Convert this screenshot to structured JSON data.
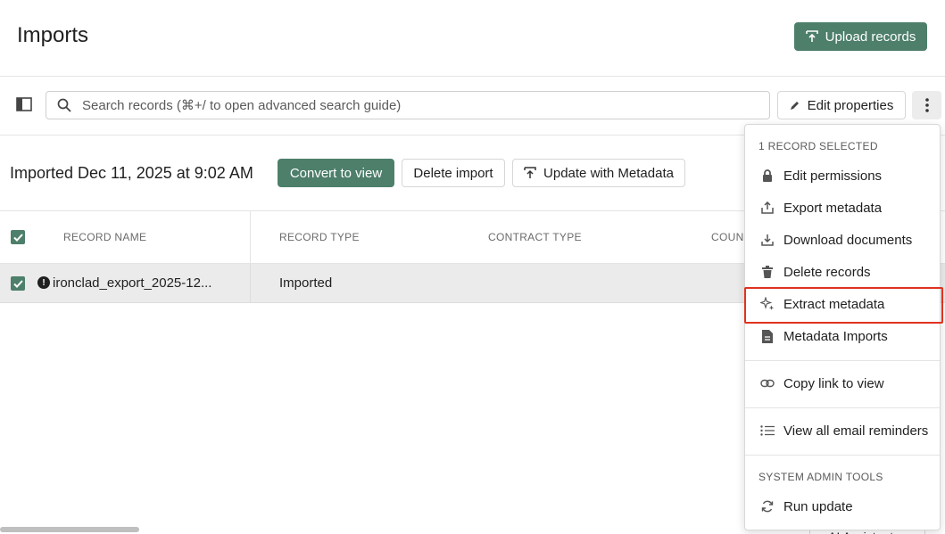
{
  "header": {
    "title": "Imports",
    "upload_label": "Upload records"
  },
  "toolbar": {
    "search_placeholder": "Search records (⌘+/ to open advanced search guide)",
    "edit_properties_label": "Edit properties"
  },
  "import_bar": {
    "title": "Imported Dec 11, 2025 at 9:02 AM",
    "convert_label": "Convert to view",
    "delete_label": "Delete import",
    "update_label": "Update with Metadata"
  },
  "table": {
    "columns": [
      "RECORD NAME",
      "RECORD TYPE",
      "CONTRACT TYPE",
      "COUN"
    ],
    "rows": [
      {
        "name": "ironclad_export_2025-12...",
        "type": "Imported"
      }
    ]
  },
  "menu": {
    "section_selected": "1 RECORD SELECTED",
    "items": [
      {
        "label": "Edit permissions",
        "icon": "lock-icon"
      },
      {
        "label": "Export metadata",
        "icon": "export-icon"
      },
      {
        "label": "Download documents",
        "icon": "download-icon"
      },
      {
        "label": "Delete records",
        "icon": "trash-icon"
      },
      {
        "label": "Extract metadata",
        "icon": "sparkle-icon"
      },
      {
        "label": "Metadata Imports",
        "icon": "document-icon"
      },
      {
        "label": "Copy link to view",
        "icon": "link-icon"
      },
      {
        "label": "View all email reminders",
        "icon": "list-icon"
      }
    ],
    "section_admin": "SYSTEM ADMIN TOOLS",
    "admin_items": [
      {
        "label": "Run update",
        "icon": "refresh-icon"
      }
    ]
  },
  "footer": {
    "ai_assistant_label": "AI Assistant"
  },
  "colors": {
    "accent": "#4d7f6b",
    "highlight": "#e0321f"
  }
}
